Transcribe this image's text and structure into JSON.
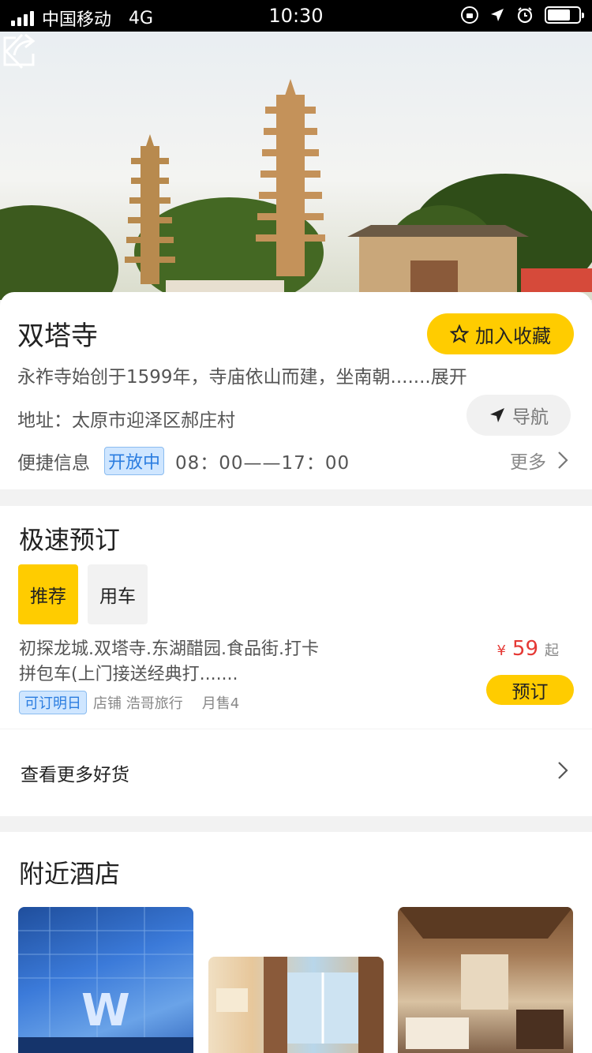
{
  "status_bar": {
    "carrier": "中国移动",
    "network": "4G",
    "time": "10:30"
  },
  "header": {
    "back_icon": "chevron-left-icon",
    "share_icon": "share-icon"
  },
  "poi": {
    "title": "双塔寺",
    "favorite_label": "加入收藏",
    "description": "永祚寺始创于1599年，寺庙依山而建，坐南朝.......展开",
    "address": "地址：太原市迎泽区郝庄村",
    "navigate_label": "导航",
    "quick_info_label": "便捷信息",
    "open_status": "开放中",
    "hours": "08：00——17：00",
    "more_label": "更多"
  },
  "booking": {
    "title": "极速预订",
    "tabs": [
      {
        "label": "推荐",
        "active": true
      },
      {
        "label": "用车",
        "active": false
      }
    ],
    "product": {
      "title": "初探龙城.双塔寺.东湖醋园.食品街.打卡拼包车(上门接送经典打.......",
      "badge": "可订明日",
      "shop": "店铺 浩哥旅行",
      "sales": "月售4",
      "currency": "¥",
      "price": "59",
      "price_suffix": "起",
      "book_label": "预订"
    }
  },
  "more_goods": {
    "label": "查看更多好货"
  },
  "hotels": {
    "title": "附近酒店"
  },
  "colors": {
    "accent": "#ffcc00",
    "price": "#e53935",
    "badge_blue": "#2b7de0"
  }
}
